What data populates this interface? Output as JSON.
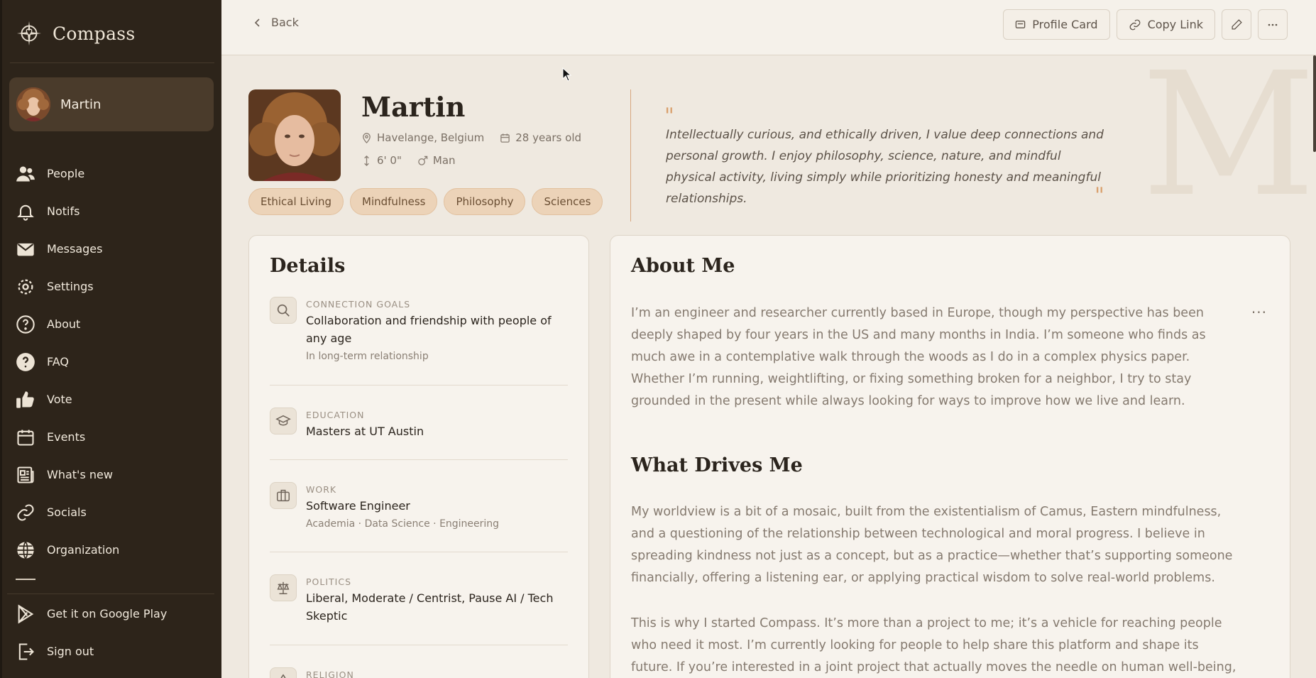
{
  "app": {
    "name": "Compass"
  },
  "sidebar": {
    "user_name": "Martin",
    "items": [
      {
        "label": "People",
        "icon": "people-icon"
      },
      {
        "label": "Notifs",
        "icon": "bell-icon"
      },
      {
        "label": "Messages",
        "icon": "mail-icon"
      },
      {
        "label": "Settings",
        "icon": "gear-icon"
      },
      {
        "label": "About",
        "icon": "question-circle-icon"
      },
      {
        "label": "FAQ",
        "icon": "question-filled-icon"
      },
      {
        "label": "Vote",
        "icon": "thumbs-up-icon"
      },
      {
        "label": "Events",
        "icon": "calendar-icon"
      },
      {
        "label": "What's new",
        "icon": "newspaper-icon"
      },
      {
        "label": "Socials",
        "icon": "link-icon"
      },
      {
        "label": "Organization",
        "icon": "globe-icon"
      }
    ],
    "bottom": [
      {
        "label": "Get it on Google Play",
        "icon": "google-play-icon"
      },
      {
        "label": "Sign out",
        "icon": "sign-out-icon"
      }
    ]
  },
  "topbar": {
    "back_label": "Back",
    "profile_card_label": "Profile Card",
    "copy_link_label": "Copy Link"
  },
  "profile": {
    "name": "Martin",
    "location": "Havelange, Belgium",
    "age": "28 years old",
    "height": "6' 0\"",
    "gender": "Man",
    "tags": [
      "Ethical Living",
      "Mindfulness",
      "Philosophy",
      "Sciences"
    ],
    "quote": "Intellectually curious, and ethically driven, I value deep connections and personal growth. I enjoy philosophy, science, nature, and mindful physical activity, living simply while prioritizing honesty and meaningful relationships.",
    "watermark": "M"
  },
  "details": {
    "title": "Details",
    "items": [
      {
        "label": "CONNECTION GOALS",
        "value": "Collaboration and friendship with people of any age",
        "sub": "In long-term relationship",
        "icon": "search-icon"
      },
      {
        "label": "EDUCATION",
        "value": "Masters at UT Austin",
        "sub": "",
        "icon": "graduation-cap-icon"
      },
      {
        "label": "WORK",
        "value": "Software Engineer",
        "sub": "Academia · Data Science · Engineering",
        "icon": "briefcase-icon"
      },
      {
        "label": "POLITICS",
        "value": "Liberal, Moderate / Centrist, Pause AI / Tech Skeptic",
        "sub": "",
        "icon": "scale-icon"
      },
      {
        "label": "RELIGION",
        "value": "",
        "sub": "",
        "icon": "religion-icon"
      }
    ]
  },
  "about": {
    "title": "About Me",
    "paragraph1": "I’m an engineer and researcher currently based in Europe, though my perspective has been deeply shaped by four years in the US and many months in India. I’m someone who finds as much awe in a contemplative walk through the woods as I do in a complex physics paper. Whether I’m running, weightlifting, or fixing something broken for a neighbor, I try to stay grounded in the present while always looking for ways to improve how we live and learn.",
    "drives_title": "What Drives Me",
    "paragraph2": "My worldview is a bit of a mosaic, built from the existentialism of Camus, Eastern mindfulness, and a questioning of the relationship between technological and moral progress. I believe in spreading kindness not just as a concept, but as a practice—whether that’s supporting someone financially, offering a listening ear, or applying practical wisdom to solve real-world problems.",
    "paragraph3": "This is why I started Compass. It’s more than a project to me; it’s a vehicle for reaching people who need it most. I’m currently looking for people to help share this platform and shape its future. If you’re interested in a joint project that actually moves the needle on human well-being, I’d love to brainstorm"
  },
  "colors": {
    "sidebar": "#2d241a",
    "accent": "#d9a06d",
    "tag_bg": "#ecd3b8"
  }
}
